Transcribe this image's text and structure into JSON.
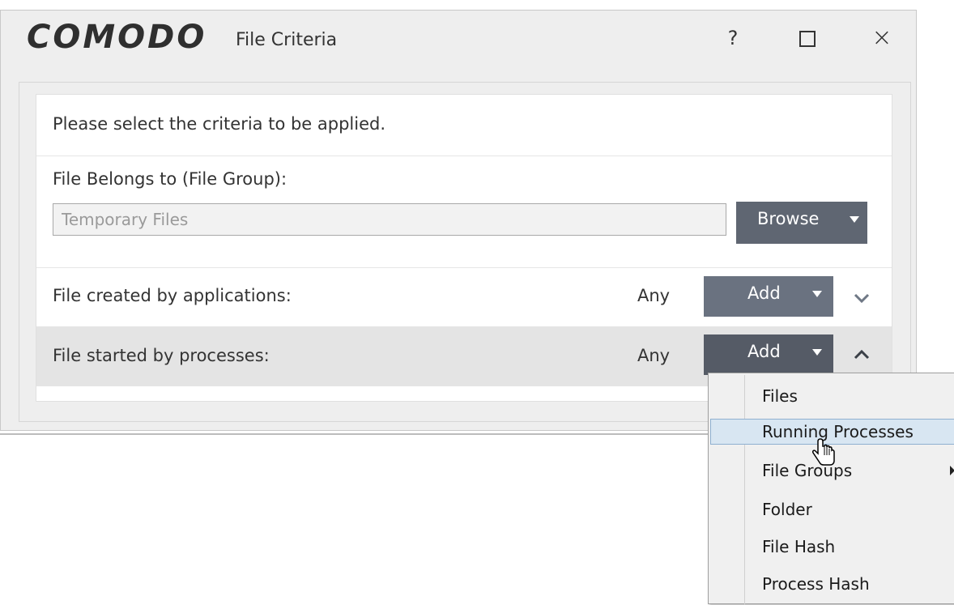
{
  "window": {
    "brand": "COMODO",
    "title": "File Criteria",
    "help_glyph": "?",
    "maximize_icon": "maximize-icon",
    "close_glyph": "×"
  },
  "form": {
    "instruction": "Please select the criteria to be applied.",
    "belongs_label": "File Belongs to (File Group):",
    "belongs_value": "Temporary Files",
    "browse_label": "Browse",
    "created_label": "File created by applications:",
    "created_value": "Any",
    "started_label": "File started by processes:",
    "started_value": "Any",
    "add_label": "Add"
  },
  "menu": {
    "items": [
      {
        "label": "Files"
      },
      {
        "label": "Running Processes",
        "highlighted": true
      },
      {
        "label": "File Groups",
        "has_submenu": true
      },
      {
        "label": "Folder"
      },
      {
        "label": "File Hash"
      },
      {
        "label": "Process Hash"
      }
    ]
  },
  "colors": {
    "browse_button": "#5f6672",
    "add_button": "#6a7280",
    "add_button_active": "#555b66",
    "menu_highlight": "#d8e6f2"
  }
}
